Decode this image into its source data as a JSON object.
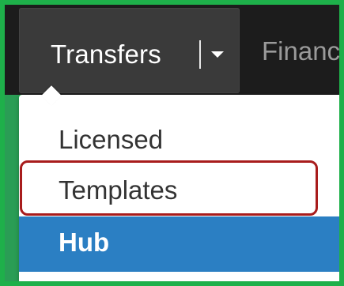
{
  "navbar": {
    "active_tab": {
      "label": "Transfers",
      "has_dropdown": true
    },
    "next_tab": {
      "label": "Financ"
    }
  },
  "dropdown": {
    "items": [
      {
        "label": "Licensed",
        "state": "normal"
      },
      {
        "label": "Templates",
        "state": "highlighted-outline"
      },
      {
        "label": "Hub",
        "state": "selected"
      }
    ]
  },
  "colors": {
    "page_border": "#1eb04a",
    "navbar_bg": "#1c1c1c",
    "active_tab_bg": "#3a3a3a",
    "selected_item_bg": "#2b7fc3",
    "outline": "#a81c1c"
  }
}
